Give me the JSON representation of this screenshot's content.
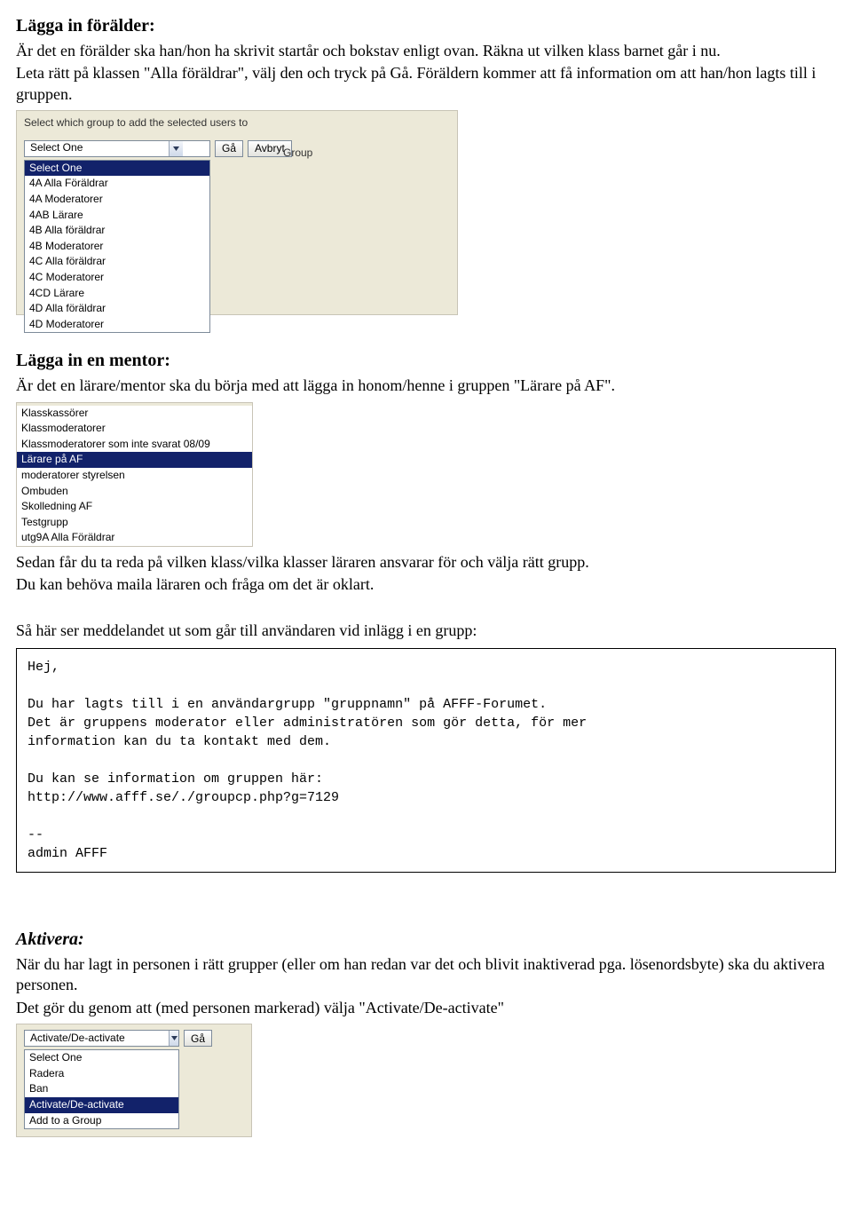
{
  "section_parent": {
    "heading": "Lägga in förälder:",
    "p1": "Är det en förälder ska han/hon ha skrivit startår och bokstav enligt ovan. Räkna ut vilken klass barnet går i nu.",
    "p2": "Leta rätt på klassen \"Alla föräldrar\", välj den och tryck på Gå. Föräldern kommer att få information om att han/hon lagts till i gruppen."
  },
  "group_widget": {
    "label": "Select which group to add the selected users to",
    "select_value": "Select One",
    "go": "Gå",
    "cancel": "Avbryt",
    "background_text": "Group",
    "items": [
      {
        "label": "Select One",
        "selected": true
      },
      {
        "label": "4A Alla Föräldrar"
      },
      {
        "label": "4A Moderatorer"
      },
      {
        "label": "4AB Lärare"
      },
      {
        "label": "4B Alla föräldrar"
      },
      {
        "label": "4B Moderatorer"
      },
      {
        "label": "4C Alla föräldrar"
      },
      {
        "label": "4C Moderatorer"
      },
      {
        "label": "4CD Lärare"
      },
      {
        "label": "4D Alla föräldrar"
      },
      {
        "label": "4D Moderatorer"
      }
    ]
  },
  "section_mentor": {
    "heading": "Lägga in en mentor:",
    "p1": "Är det en lärare/mentor ska du börja med att lägga in honom/henne i gruppen \"Lärare på AF\"."
  },
  "mentor_list": {
    "items": [
      {
        "label": "Klasskassörer"
      },
      {
        "label": "Klassmoderatorer"
      },
      {
        "label": "Klassmoderatorer som inte svarat 08/09"
      },
      {
        "label": "Lärare på AF",
        "selected": true
      },
      {
        "label": "moderatorer styrelsen"
      },
      {
        "label": "Ombuden"
      },
      {
        "label": "Skolledning AF"
      },
      {
        "label": "Testgrupp"
      },
      {
        "label": "utg9A Alla Föräldrar"
      }
    ]
  },
  "section_mentor2": {
    "p1": "Sedan får du ta reda på vilken klass/vilka klasser läraren ansvarar för och välja rätt grupp.",
    "p2": "Du kan behöva maila läraren och fråga om det är oklart."
  },
  "message_intro": "Så här ser meddelandet ut som går till användaren vid inlägg i en grupp:",
  "message_body": "Hej,\n\nDu har lagts till i en användargrupp \"gruppnamn\" på AFFF-Forumet.\nDet är gruppens moderator eller administratören som gör detta, för mer\ninformation kan du ta kontakt med dem.\n\nDu kan se information om gruppen här:\nhttp://www.afff.se/./groupcp.php?g=7129\n\n--\nadmin AFFF",
  "section_activate": {
    "heading": "Aktivera:",
    "p1": "När du har lagt in personen i rätt grupper (eller om han redan var det och blivit inaktiverad pga. lösenordsbyte) ska du aktivera personen.",
    "p2": "Det gör du genom att (med personen markerad) välja \"Activate/De-activate\""
  },
  "activate_widget": {
    "select_value": "Activate/De-activate",
    "go": "Gå",
    "items": [
      {
        "label": "Select One"
      },
      {
        "label": "Radera"
      },
      {
        "label": "Ban"
      },
      {
        "label": "Activate/De-activate",
        "selected": true
      },
      {
        "label": "Add to a Group"
      }
    ]
  }
}
